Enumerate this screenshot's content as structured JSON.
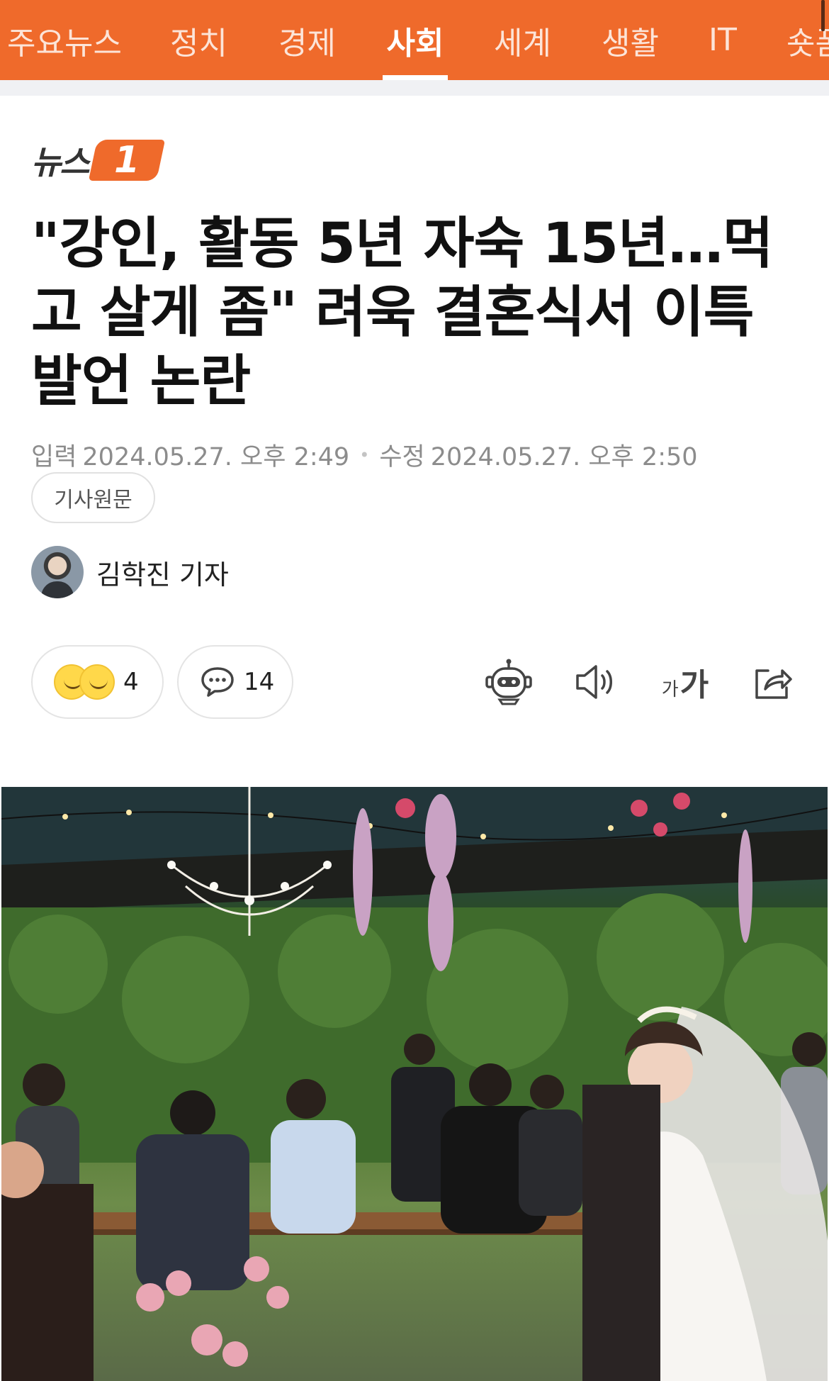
{
  "nav": {
    "items": [
      "주요뉴스",
      "정치",
      "경제",
      "사회",
      "세계",
      "생활",
      "IT",
      "숏폼"
    ],
    "active": "사회",
    "accent_color": "#ef6a2b"
  },
  "logo": {
    "text": "뉴스",
    "badge": "1"
  },
  "article": {
    "title": "\"강인, 활동 5년 자숙 15년…먹고 살게 좀\" 려욱 결혼식서 이특 발언 논란",
    "posted_label": "입력",
    "posted": "2024.05.27. 오후 2:49",
    "modified_label": "수정",
    "modified": "2024.05.27. 오후 2:50",
    "source_button": "기사원문",
    "author": "김학진 기자"
  },
  "actions": {
    "reactions_count": "4",
    "comments_count": "14",
    "font_small": "가",
    "font_large": "가",
    "icons": [
      "reaction-faces-icon",
      "comment-icon",
      "robot-summary-icon",
      "speaker-icon",
      "font-size-icon",
      "share-icon"
    ]
  },
  "photo": {
    "subject": "outdoor wedding ceremony with bride in veil and seated guests"
  }
}
